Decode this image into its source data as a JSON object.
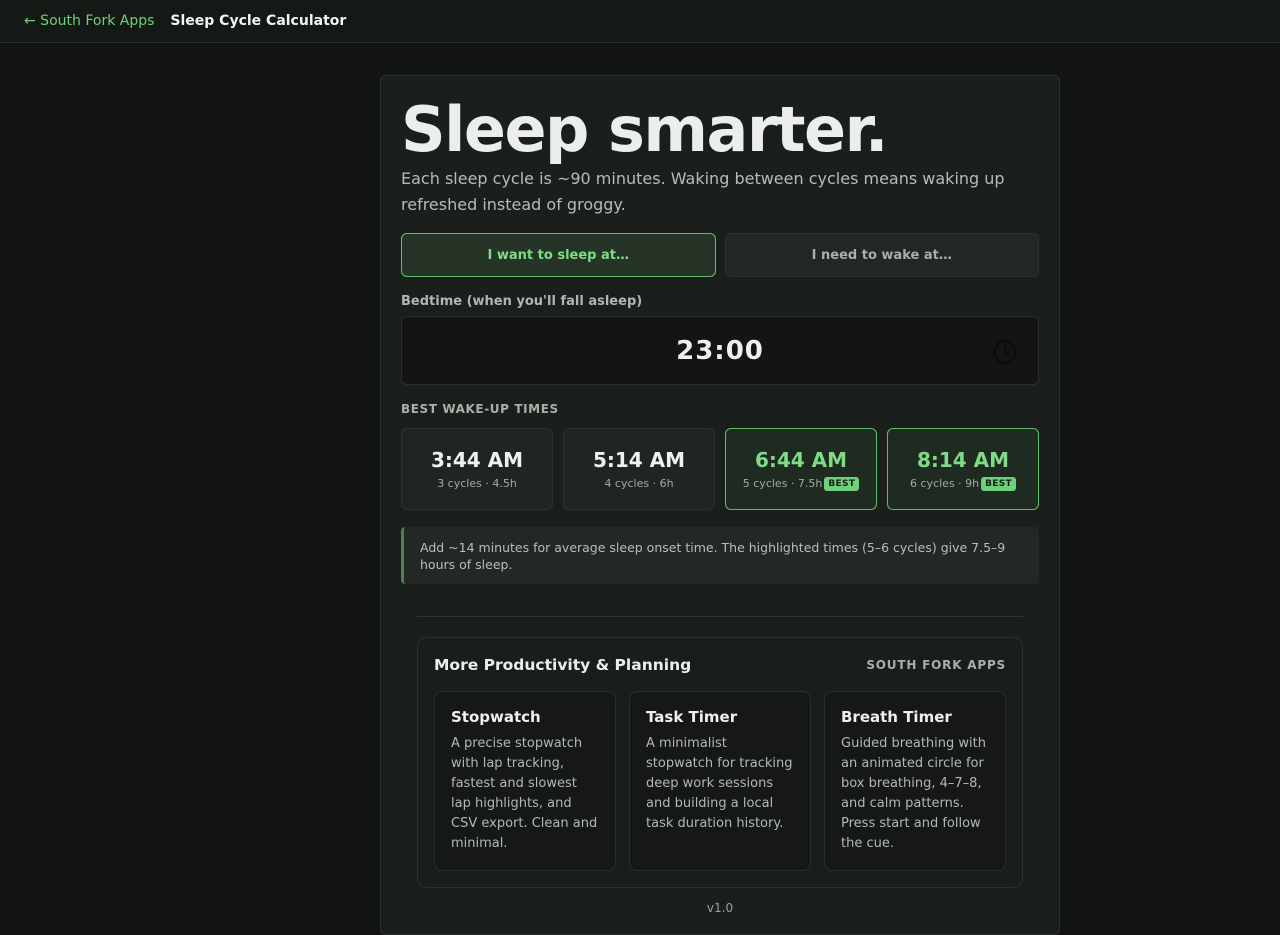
{
  "topbar": {
    "back_link": "← South Fork Apps",
    "title": "Sleep Cycle Calculator"
  },
  "hero": {
    "headline": "Sleep smarter.",
    "subtitle": "Each sleep cycle is ~90 minutes. Waking between cycles means waking up refreshed instead of groggy."
  },
  "modes": [
    {
      "label": "I want to sleep at…",
      "active": true
    },
    {
      "label": "I need to wake at…",
      "active": false
    }
  ],
  "bedtime": {
    "label": "Bedtime (when you'll fall asleep)",
    "value": "23:00",
    "icon": "clock-icon"
  },
  "wake_times": {
    "label": "BEST WAKE-UP TIMES",
    "items": [
      {
        "time": "3:44 AM",
        "meta": "3 cycles · 4.5h",
        "best": false,
        "badge": ""
      },
      {
        "time": "5:14 AM",
        "meta": "4 cycles · 6h",
        "best": false,
        "badge": ""
      },
      {
        "time": "6:44 AM",
        "meta": "5 cycles · 7.5h",
        "best": true,
        "badge": "BEST"
      },
      {
        "time": "8:14 AM",
        "meta": "6 cycles · 9h",
        "best": true,
        "badge": "BEST"
      }
    ]
  },
  "note": "Add ~14 minutes for average sleep onset time. The highlighted times (5–6 cycles) give 7.5–9 hours of sleep.",
  "more": {
    "title": "More Productivity & Planning",
    "brand": "SOUTH FORK APPS",
    "apps": [
      {
        "name": "Stopwatch",
        "desc": "A precise stopwatch with lap tracking, fastest and slowest lap highlights, and CSV export. Clean and minimal."
      },
      {
        "name": "Task Timer",
        "desc": "A minimalist stopwatch for tracking deep work sessions and building a local task duration history."
      },
      {
        "name": "Breath Timer",
        "desc": "Guided breathing with an animated circle for box breathing, 4–7–8, and calm patterns. Press start and follow the cue."
      }
    ]
  },
  "version": "v1.0",
  "colors": {
    "accent": "#6fcf7a",
    "background": "#111412",
    "card": "#1b1f1c"
  }
}
